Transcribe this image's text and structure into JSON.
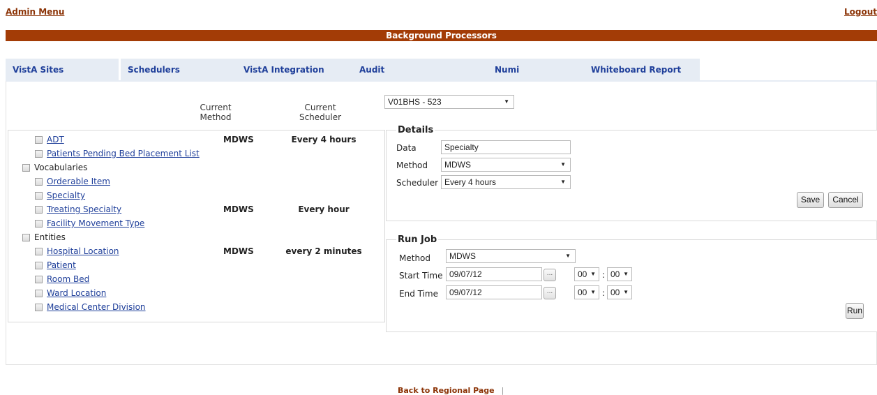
{
  "header": {
    "admin_menu": "Admin Menu",
    "logout": "Logout",
    "title": "Background Processors"
  },
  "tabs": [
    {
      "label": "VistA Sites"
    },
    {
      "label": "Schedulers"
    },
    {
      "label": "VistA Integration"
    },
    {
      "label": "Audit"
    },
    {
      "label": "Numi"
    },
    {
      "label": "Whiteboard Report"
    }
  ],
  "columns": {
    "method": "Current\nMethod",
    "scheduler": "Current\nScheduler"
  },
  "site_select": "V01BHS - 523",
  "tree": [
    {
      "label": "ADT",
      "link": true,
      "level": 1,
      "method": "MDWS",
      "scheduler": "Every 4 hours"
    },
    {
      "label": "Patients Pending Bed Placement List",
      "link": true,
      "level": 1,
      "method": "",
      "scheduler": ""
    },
    {
      "label": "Vocabularies",
      "link": false,
      "level": 0,
      "method": "",
      "scheduler": ""
    },
    {
      "label": "Orderable Item",
      "link": true,
      "level": 1,
      "method": "",
      "scheduler": ""
    },
    {
      "label": "Specialty",
      "link": true,
      "level": 1,
      "method": "",
      "scheduler": ""
    },
    {
      "label": "Treating Specialty",
      "link": true,
      "level": 1,
      "method": "MDWS",
      "scheduler": "Every hour"
    },
    {
      "label": "Facility Movement Type",
      "link": true,
      "level": 1,
      "method": "",
      "scheduler": ""
    },
    {
      "label": "Entities",
      "link": false,
      "level": 0,
      "method": "",
      "scheduler": ""
    },
    {
      "label": "Hospital Location",
      "link": true,
      "level": 1,
      "method": "MDWS",
      "scheduler": "every 2 minutes"
    },
    {
      "label": "Patient",
      "link": true,
      "level": 1,
      "method": "",
      "scheduler": ""
    },
    {
      "label": "Room Bed",
      "link": true,
      "level": 1,
      "method": "",
      "scheduler": ""
    },
    {
      "label": "Ward Location",
      "link": true,
      "level": 1,
      "method": "",
      "scheduler": ""
    },
    {
      "label": "Medical Center Division",
      "link": true,
      "level": 1,
      "method": "",
      "scheduler": ""
    }
  ],
  "details": {
    "legend": "Details",
    "data_label": "Data",
    "data_value": "Specialty",
    "method_label": "Method",
    "method_value": "MDWS",
    "scheduler_label": "Scheduler",
    "scheduler_value": "Every 4 hours",
    "save": "Save",
    "cancel": "Cancel"
  },
  "run_job": {
    "legend": "Run Job",
    "method_label": "Method",
    "method_value": "MDWS",
    "start_label": "Start Time",
    "start_date": "09/07/12",
    "start_hour": "00",
    "start_min": "00",
    "end_label": "End Time",
    "end_date": "09/07/12",
    "end_hour": "00",
    "end_min": "00",
    "dots": "...",
    "colon": ":",
    "run": "Run"
  },
  "footer": {
    "back_link": "Back to Regional Page",
    "separator": "|"
  }
}
